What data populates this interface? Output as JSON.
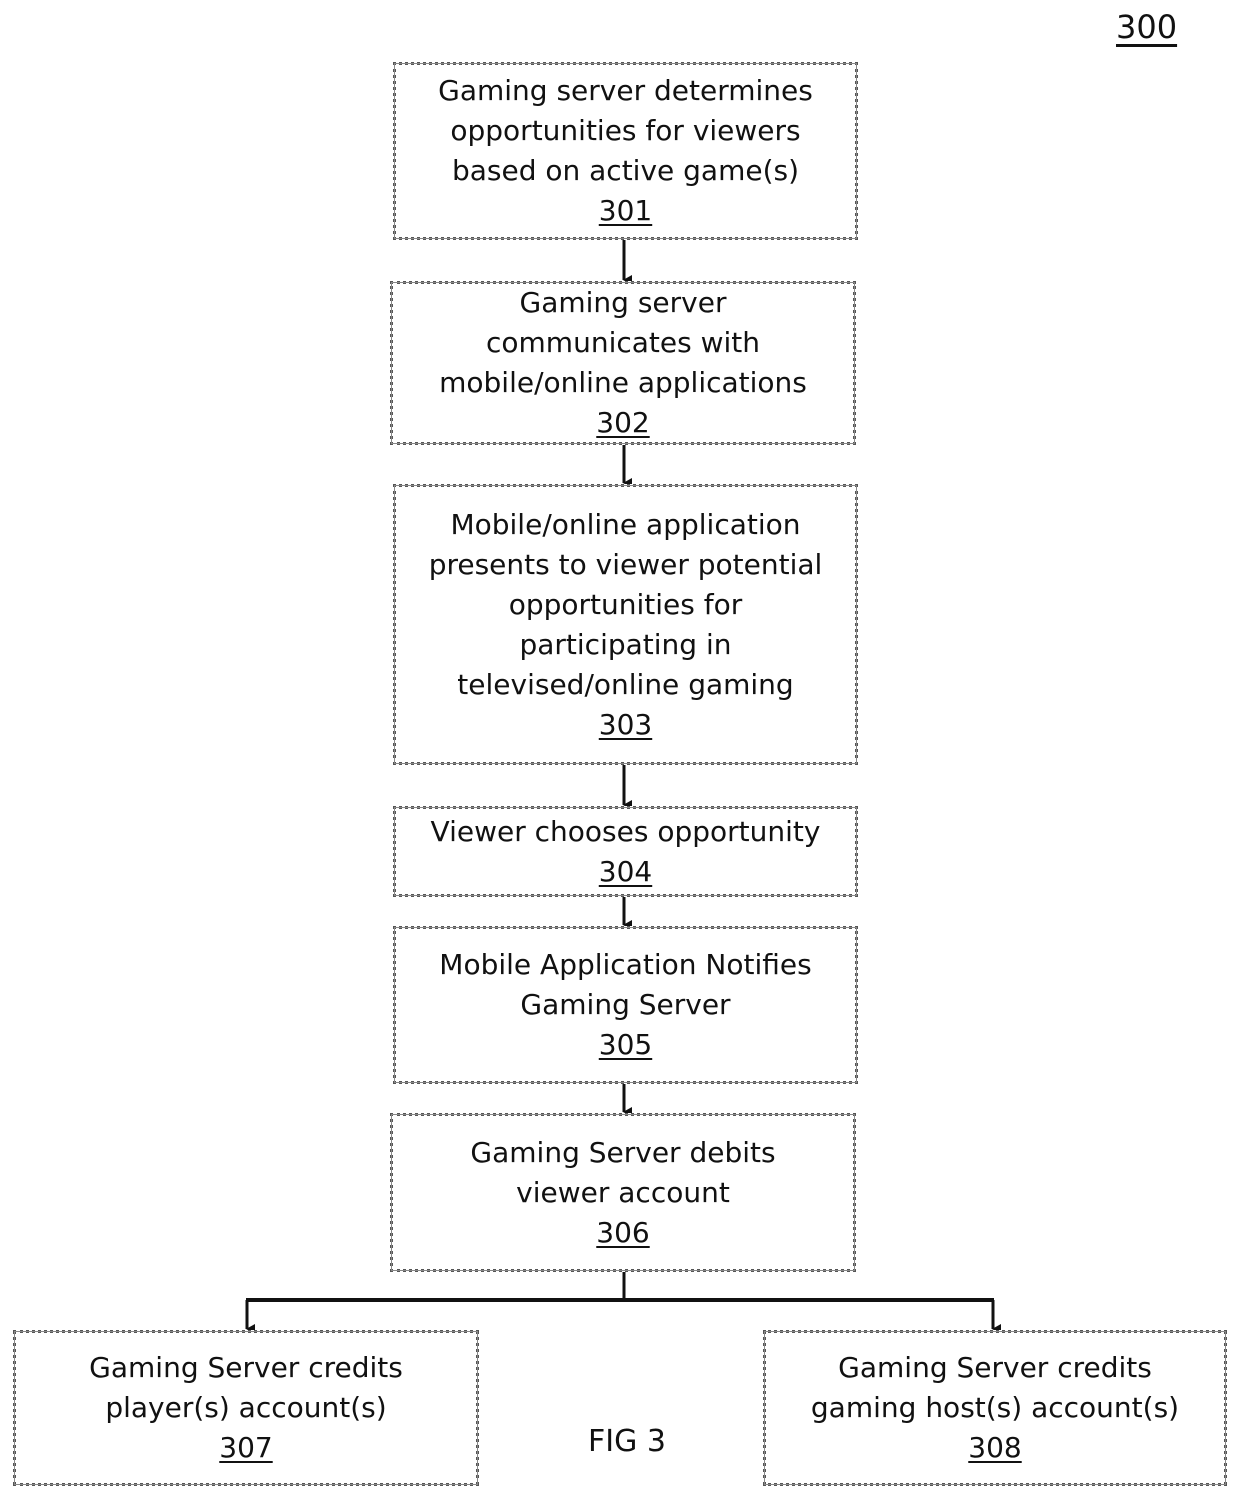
{
  "figure": {
    "ref": "300",
    "caption": "FIG 3"
  },
  "boxes": [
    {
      "id": "301",
      "lines": [
        "Gaming server determines",
        "opportunities for viewers",
        "based on active game(s)"
      ],
      "ref": "301"
    },
    {
      "id": "302",
      "lines": [
        "Gaming server",
        "communicates with",
        "mobile/online applications"
      ],
      "ref": "302"
    },
    {
      "id": "303",
      "lines": [
        "Mobile/online application",
        "presents to viewer potential",
        "opportunities for",
        "participating in",
        "televised/online gaming"
      ],
      "ref": "303"
    },
    {
      "id": "304",
      "lines": [
        "Viewer chooses opportunity"
      ],
      "ref": "304"
    },
    {
      "id": "305",
      "lines": [
        "Mobile Application Notifies",
        "Gaming Server"
      ],
      "ref": "305"
    },
    {
      "id": "306",
      "lines": [
        "Gaming Server debits",
        "viewer account"
      ],
      "ref": "306"
    },
    {
      "id": "307",
      "lines": [
        "Gaming Server credits",
        "player(s) account(s)"
      ],
      "ref": "307"
    },
    {
      "id": "308",
      "lines": [
        "Gaming Server credits",
        "gaming host(s) account(s)"
      ],
      "ref": "308"
    }
  ],
  "edges": [
    {
      "from": "301",
      "to": "302"
    },
    {
      "from": "302",
      "to": "303"
    },
    {
      "from": "303",
      "to": "304"
    },
    {
      "from": "304",
      "to": "305"
    },
    {
      "from": "305",
      "to": "306"
    },
    {
      "from": "306",
      "to": "307"
    },
    {
      "from": "306",
      "to": "308"
    }
  ]
}
